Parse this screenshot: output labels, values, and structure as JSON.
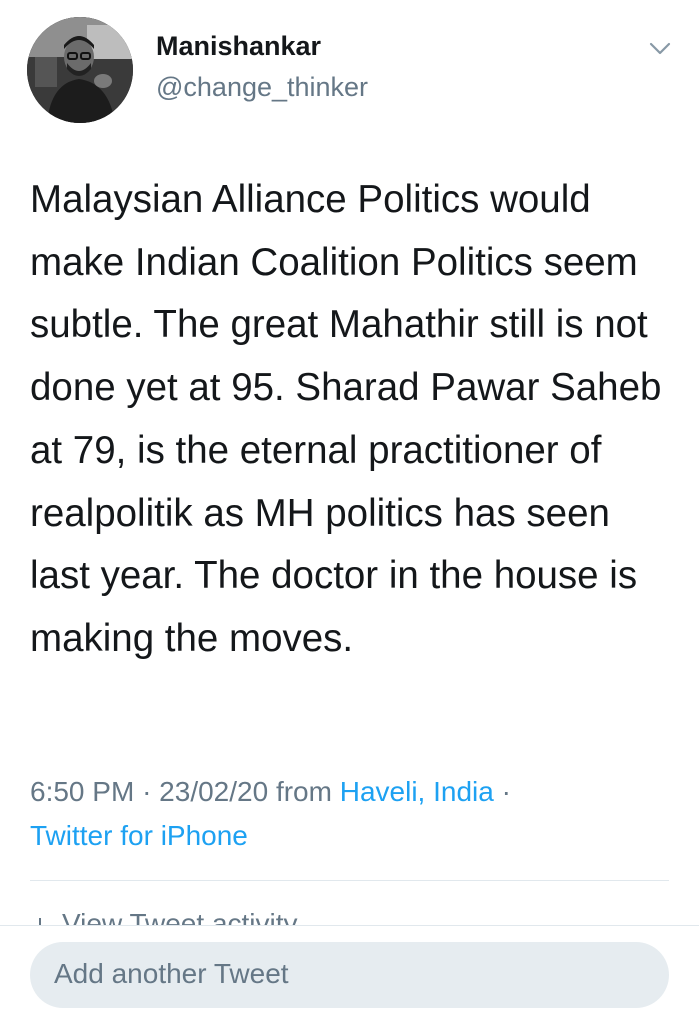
{
  "author": {
    "name": "Manishankar",
    "handle": "@change_thinker"
  },
  "tweet": {
    "text": "Malaysian Alliance Politics would make Indian Coalition Politics seem subtle. The great Mahathir still is not done yet at 95. Sharad Pawar Saheb at 79, is the eternal practitioner of realpolitik as MH politics has seen last year. The doctor in the house is making the moves."
  },
  "meta": {
    "time": "6:50 PM",
    "separator": "·",
    "date": "23/02/20",
    "from_label": "from",
    "location": "Haveli, India",
    "source": "Twitter for iPhone"
  },
  "activity": {
    "label": "View Tweet activity",
    "icon": "bar-chart-icon"
  },
  "reply": {
    "placeholder": "Add another Tweet"
  },
  "icons": {
    "menu": "chevron-down-icon"
  },
  "colors": {
    "link": "#1da1f2",
    "secondary_text": "#657786",
    "primary_text": "#14171a",
    "input_background": "#e6ecf0",
    "divider": "#e1e8ed"
  }
}
